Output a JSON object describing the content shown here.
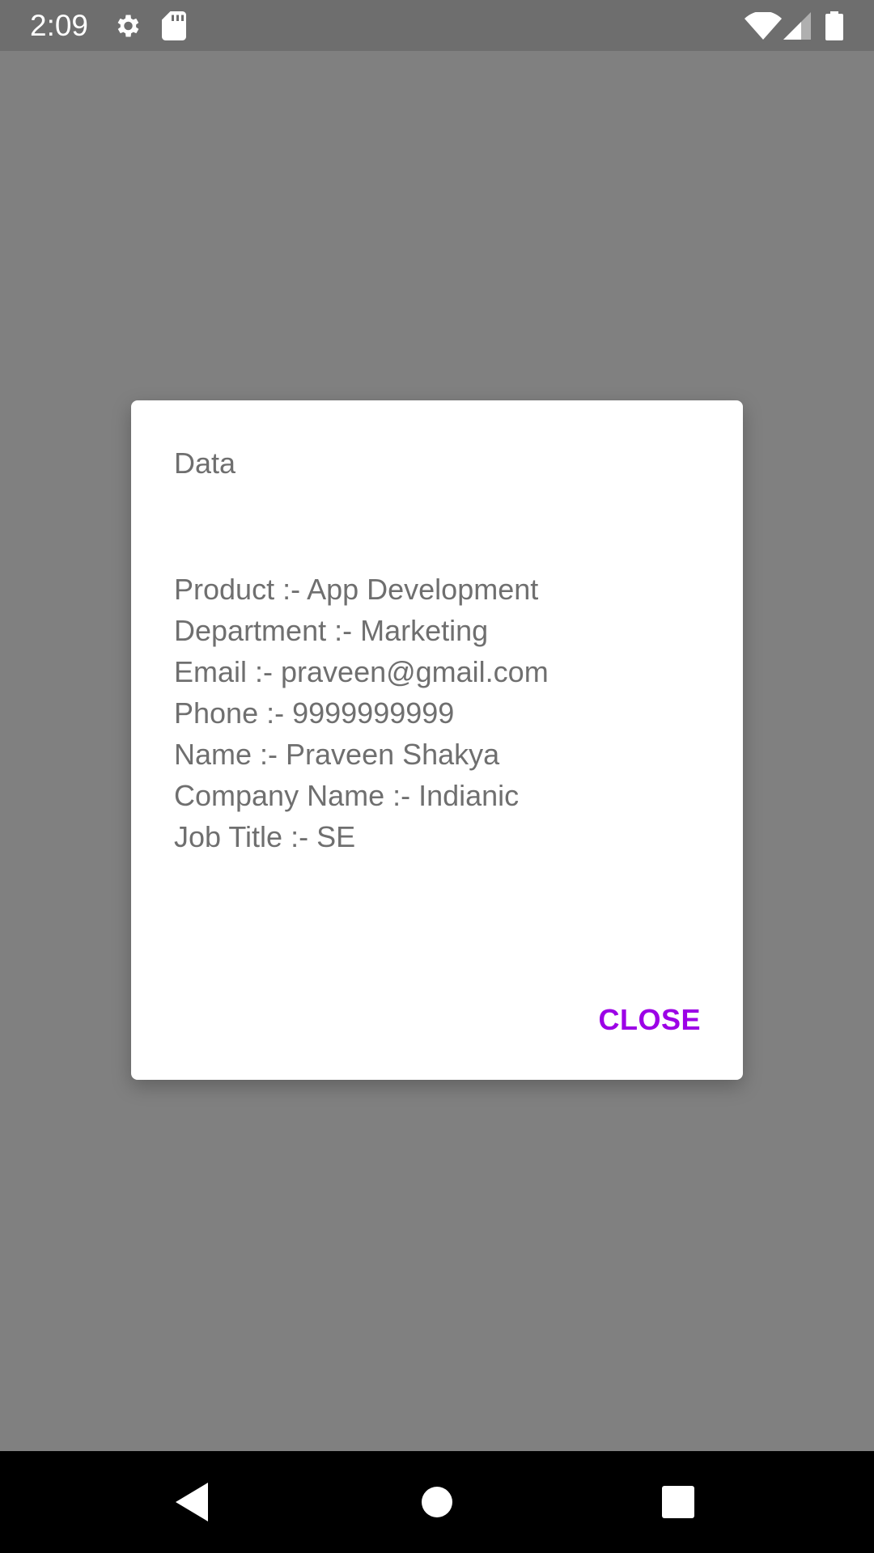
{
  "status_bar": {
    "time": "2:09",
    "icons": [
      "gear-icon",
      "sdcard-icon",
      "wifi-icon",
      "signal-icon",
      "battery-icon"
    ]
  },
  "dialog": {
    "title": "Data",
    "lines": [
      "Product :- App Development",
      "Department :- Marketing",
      "Email :- praveen@gmail.com",
      "Phone :- 9999999999",
      "Name :- Praveen Shakya",
      "Company Name :- Indianic",
      "Job Title :- SE"
    ],
    "close_label": "CLOSE"
  },
  "nav_bar": {
    "icons": [
      "back-icon",
      "home-icon",
      "recents-icon"
    ]
  },
  "colors": {
    "scrim": "#808080",
    "accent": "#9c00e6",
    "text": "#6f6f6f"
  }
}
